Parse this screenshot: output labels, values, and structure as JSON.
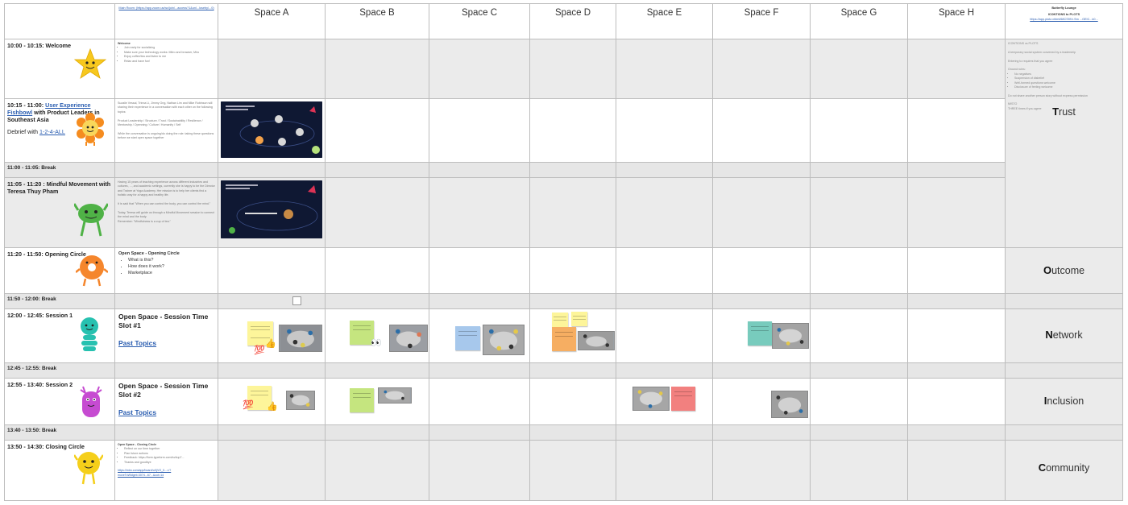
{
  "header": {
    "spaces": [
      "Space A",
      "Space B",
      "Space C",
      "Space D",
      "Space E",
      "Space F",
      "Space G",
      "Space H"
    ],
    "main_room": "Main Room: (https://app.zoom.us/wc/join/...access?1&unl...loseby/...0)",
    "butterfly_title": "Butterfly Lounge",
    "butterfly_sub": "ICONTIONS to PLOTS",
    "butterfly_link": "https://app.plotz.xhtml/68CS99.t.Sm ...GEIC...k0..."
  },
  "rows": {
    "welcome": {
      "time": "10:00 - 10:15: Welcome",
      "notes_title": "Welcome",
      "notes": [
        "Join early for socializing",
        "Make sure your technology works: Mitro and browser, Miro",
        "Enjoy coffee/tea and listen to me",
        "Relax and have fun!"
      ]
    },
    "fishbowl": {
      "time_prefix": "10:15 - 11:00: ",
      "time_link": "User Experience Fishbowl",
      "time_suffix": " with Product Leaders in Southeast Asia",
      "debrief_prefix": "Debrief with ",
      "debrief_link": "1-2-4-ALL",
      "notes": [
        "Suzalie Vessal, Trinna Li, Jimmy Ong, Nathan Lim and Mike Robinson will sharing their experience in a conversation with each other on the following topics:",
        "Product Leadership / Structure / Trust / Sustainability / Resilience / Mentorship / Openning / Culture / Humanity / Self",
        "While the conversation is ongoing/do doing the role: taking these questions before we start open space together"
      ]
    },
    "break1": {
      "time": "11:00 - 11:05: Break"
    },
    "mindful": {
      "time": "11:05 - 11:20 : Mindful Movement with Teresa Thuy Pham",
      "notes": [
        "Having 15 years of teaching experience across different industries and cultures, ..., and academic settings, currently she is happy to be the Director and Trainer at Yoga Academy. Her mission is to help her clients find a holistic way for a happy and healthy life.",
        "It is said that \"When you can control the body, you can control the mind.\"",
        "Today, Teresa will guide us through a Mindful Movement session to connect the mind and the body.",
        "Remember: \"Mindfulness is a cup of tea.\""
      ]
    },
    "opening": {
      "time": "11:20 - 11:50: Opening Circle",
      "notes_title": "Open Space - Opening Circle",
      "notes": [
        "What is this?",
        "How does it work?",
        "Marketplace"
      ]
    },
    "break2": {
      "time": "11:50 - 12:00: Break"
    },
    "session1": {
      "time": "12:00 - 12:45: Session 1",
      "title": "Open Space - Session Time Slot #1",
      "link": "Past Topics"
    },
    "break3": {
      "time": "12:45 - 12:55: Break"
    },
    "session2": {
      "time": "12:55 - 13:40: Session 2",
      "title": "Open Space - Session Time Slot #2",
      "link": "Past Topics"
    },
    "break4": {
      "time": "13:40 - 13:50: Break"
    },
    "closing": {
      "time": "13:50 - 14:30: Closing Circle",
      "notes_title": "Open Space - Closing Circle",
      "notes": [
        "Reflect on our time together",
        "Plan future actions",
        "Feedback: https://form.typeform.com/to/dup7...",
        "Thanks and goodbye"
      ],
      "links": [
        "https://miro.com/app/board/uXjVO_0...=/?",
        "moveToWidget=3074...67...&cot=14"
      ]
    }
  },
  "butterfly_notes": [
    "ICONTIONS vs PLOTS",
    "A temporary social system convened by a leadership",
    "Entering to requires that you agree",
    "Ground rules:",
    "No negatives",
    "Suspension of disbelief",
    "Well-formed questions welcome",
    "Disclosure of feeling welcome",
    "Do not share another person story without express permission",
    "MISTO",
    "THREE times if you agree"
  ],
  "values": [
    {
      "initial": "T",
      "rest": "rust"
    },
    {
      "initial": "O",
      "rest": "utcome"
    },
    {
      "initial": "N",
      "rest": "etwork"
    },
    {
      "initial": "I",
      "rest": "nclusion"
    },
    {
      "initial": "C",
      "rest": "ommunity"
    }
  ],
  "emojis": {
    "hundred": "💯",
    "thumbs": "👍",
    "eyes": "👀"
  },
  "colors": {
    "grid": "#bdbdbd",
    "cell_grey": "#ebebeb",
    "break_grey": "#e6e6e6",
    "link": "#2a5db0",
    "sticky_yellow": "#fdf59a",
    "sticky_green": "#c5e57f",
    "sticky_blue": "#a7c8ec",
    "sticky_orange": "#f6ae62",
    "sticky_teal": "#78cbbd",
    "sticky_pink": "#f2807f"
  }
}
